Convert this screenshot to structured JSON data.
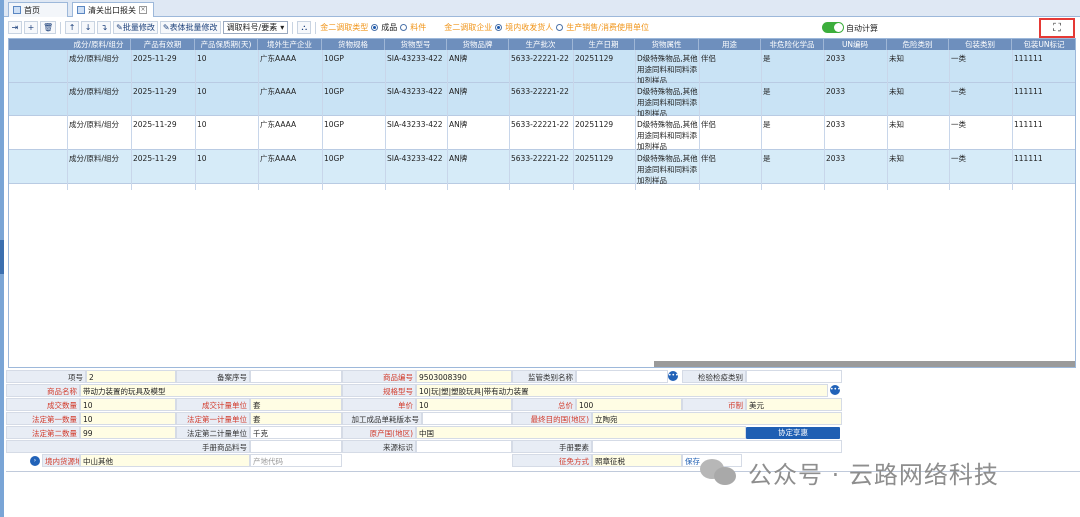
{
  "tabs": [
    {
      "label": "首页"
    },
    {
      "label": "清关出口报关"
    }
  ],
  "toolbar": {
    "btn_batch_modify": "批量修改",
    "btn_table_batch_modify": "表体批量修改",
    "select_value": "调取料号/要素",
    "group1_label": "金二调取类型",
    "group1_opt1": "成品",
    "group1_opt2": "料件",
    "group2_label": "金二调取企业",
    "group2_opt1": "境内收发货人",
    "group2_opt2": "生产销售/消费使用单位",
    "auto_calc": "自动计算",
    "fullscreen_icon": "⛶"
  },
  "grid": {
    "columns": [
      "成分/原料/组分",
      "产品有效期",
      "产品保质期(天)",
      "境外生产企业",
      "货物规格",
      "货物型号",
      "货物品牌",
      "生产批次",
      "生产日期",
      "货物属性",
      "用途",
      "非危险化学品",
      "UN编码",
      "危险类别",
      "包装类别",
      "包装UN标记"
    ],
    "rows": [
      {
        "c0": "成分/原料/组分",
        "c1": "2025-11-29",
        "c2": "10",
        "c3": "广东AAAA",
        "c4": "10GP",
        "c5": "SIA-43233-422",
        "c6": "AN牌",
        "c7": "5633-22221-22",
        "c8": "20251129",
        "c9": "D级特殊物品,其他用途同料和同料添加剂样品",
        "c10": "伴侣",
        "c11": "是",
        "c12": "2033",
        "c13": "未知",
        "c14": "一类",
        "c15": "111111"
      },
      {
        "c0": "成分/原料/组分",
        "c1": "2025-11-29",
        "c2": "10",
        "c3": "广东AAAA",
        "c4": "10GP",
        "c5": "SIA-43233-422",
        "c6": "AN牌",
        "c7": "5633-22221-22",
        "c8": "",
        "c9": "D级特殊物品,其他用途同料和同料添加剂样品",
        "c10": "",
        "c11": "是",
        "c12": "2033",
        "c13": "未知",
        "c14": "一类",
        "c15": "111111"
      },
      {
        "c0": "成分/原料/组分",
        "c1": "2025-11-29",
        "c2": "10",
        "c3": "广东AAAA",
        "c4": "10GP",
        "c5": "SIA-43233-422",
        "c6": "AN牌",
        "c7": "5633-22221-22",
        "c8": "20251129",
        "c9": "D级特殊物品,其他用途同料和同料添加剂样品",
        "c10": "伴侣",
        "c11": "是",
        "c12": "2033",
        "c13": "未知",
        "c14": "一类",
        "c15": "111111"
      },
      {
        "c0": "成分/原料/组分",
        "c1": "2025-11-29",
        "c2": "10",
        "c3": "广东AAAA",
        "c4": "10GP",
        "c5": "SIA-43233-422",
        "c6": "AN牌",
        "c7": "5633-22221-22",
        "c8": "20251129",
        "c9": "D级特殊物品,其他用途同料和同料添加剂样品",
        "c10": "伴侣",
        "c11": "是",
        "c12": "2033",
        "c13": "未知",
        "c14": "一类",
        "c15": "111111"
      }
    ]
  },
  "form": {
    "item_no_label": "项号",
    "item_no": "2",
    "record_no_label": "备案序号",
    "record_no": "",
    "hs_code_label": "商品编号",
    "hs_code": "9503008390",
    "supervision_label": "监管类别名称",
    "supervision": "",
    "inspection_label": "检验检疫类别",
    "inspection": "",
    "goods_name_label": "商品名称",
    "goods_name": "带动力装置的玩具及模型",
    "spec_label": "规格型号",
    "spec": "10|玩|塑|塑胶玩具|带有动力装置",
    "qty_label": "成交数量",
    "qty": "10",
    "unit_label": "成交计量单位",
    "unit": "套",
    "price_label": "单价",
    "price": "10",
    "total_label": "总价",
    "total": "100",
    "currency_label": "币制",
    "currency": "美元",
    "legal_qty1_label": "法定第一数量",
    "legal_qty1": "10",
    "legal_unit1_label": "法定第一计量单位",
    "legal_unit1": "套",
    "process_label": "加工成品单耗版本号",
    "process": "",
    "dest_label": "最终目的国(地区)",
    "dest": "立陶宛",
    "legal_qty2_label": "法定第二数量",
    "legal_qty2": "99",
    "legal_unit2_label": "法定第二计量单位",
    "legal_unit2": "千克",
    "origin_label": "原产国(地区)",
    "origin": "中国",
    "agreement_btn": "协定享惠",
    "manual_label": "手册商品料号",
    "manual": "",
    "source_label": "来源标识",
    "source": "",
    "manual_elem_label": "手册要素",
    "manual_elem": "",
    "domestic_src_label": "境内货源地",
    "domestic_src": "中山其他",
    "origin_code_placeholder": "产地代码",
    "tax_label": "征免方式",
    "tax": "照章征税",
    "save_link": "保存"
  },
  "watermark": {
    "text": "公众号 · 云路网络科技"
  }
}
